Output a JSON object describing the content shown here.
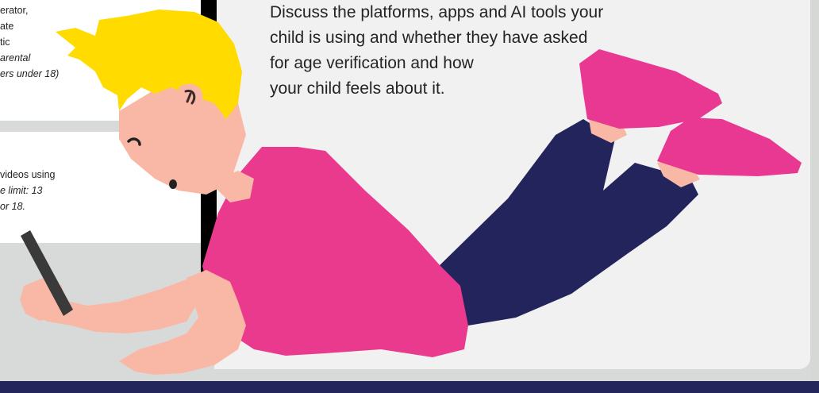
{
  "cards": {
    "top": {
      "lines": [
        "erator,",
        "ate",
        "tic"
      ],
      "italic_lines": [
        "arental",
        "ers under 18)"
      ]
    },
    "bottom": {
      "lines": [
        "videos using"
      ],
      "italic_lines": [
        "e limit: 13",
        "or 18."
      ]
    }
  },
  "main_text": {
    "line1": "Discuss the platforms, apps and AI tools your",
    "line2": "child is using and whether they have asked",
    "line3": "for age verification and how",
    "line4": "your child feels about it."
  },
  "colors": {
    "hair": "#ffdb00",
    "shirt": "#ea3a8e",
    "pants": "#23245c",
    "skin": "#f9b8a6",
    "shoe": "#e93891",
    "phone": "#3a3a3a",
    "bottom_bar": "#23265a",
    "panel_bg": "#f1f1f1"
  },
  "illustration": {
    "subject": "child-lying-with-phone"
  }
}
